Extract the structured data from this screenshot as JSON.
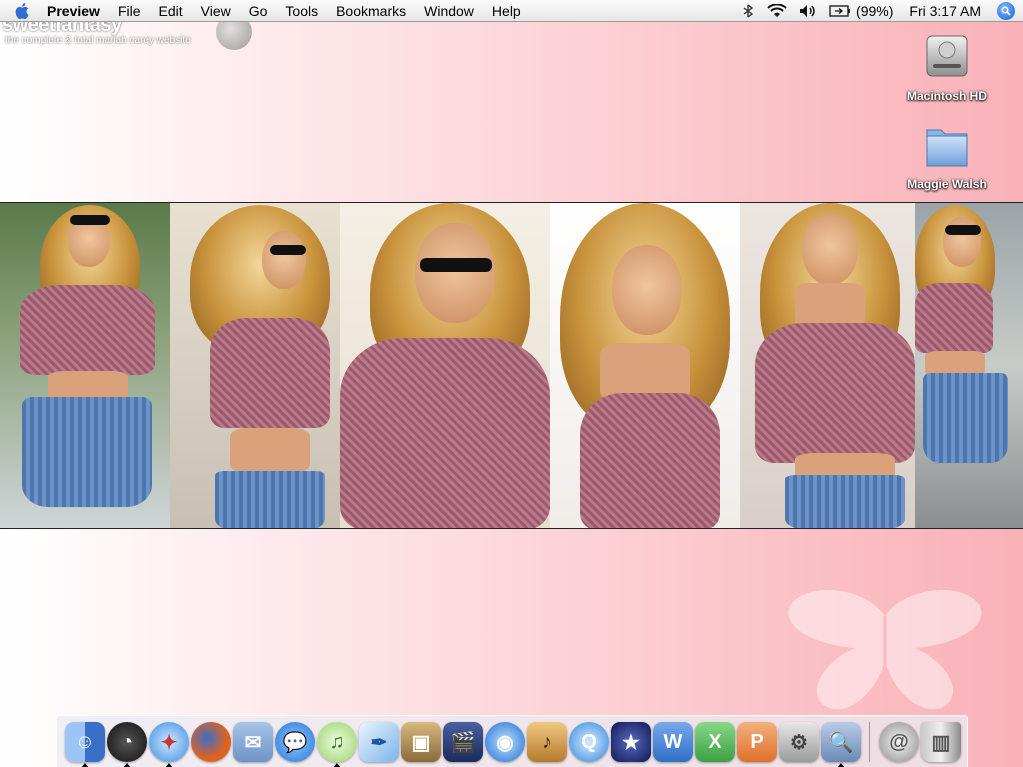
{
  "menubar": {
    "app_name": "Preview",
    "items": [
      "File",
      "Edit",
      "View",
      "Go",
      "Tools",
      "Bookmarks",
      "Window",
      "Help"
    ],
    "battery": "(99%)",
    "clock": "Fri 3:17 AM"
  },
  "wallpaper": {
    "site_name": "sweetfantasy",
    "tagline": "the complete & total mariah carey website"
  },
  "desktop_icons": [
    {
      "label": "Macintosh HD",
      "icon": "hard-drive-icon"
    },
    {
      "label": "Maggie Walsh",
      "icon": "folder-icon"
    }
  ],
  "dock": {
    "apps": [
      {
        "icon": "finder-icon",
        "color": "#4a7fd0"
      },
      {
        "icon": "dashboard-icon",
        "color": "#2b2b2b"
      },
      {
        "icon": "safari-icon",
        "color": "#3b8fe0"
      },
      {
        "icon": "firefox-icon",
        "color": "#e0621f"
      },
      {
        "icon": "mail-icon",
        "color": "#6c93c9"
      },
      {
        "icon": "ichat-icon",
        "color": "#3a8ee6"
      },
      {
        "icon": "itunes-icon",
        "color": "#6fb53a"
      },
      {
        "icon": "feather-icon",
        "color": "#3e88c5"
      },
      {
        "icon": "iphoto-icon",
        "color": "#8a6a3a"
      },
      {
        "icon": "imovie-icon",
        "color": "#2a3f7a"
      },
      {
        "icon": "idvd-icon",
        "color": "#1f6fd6"
      },
      {
        "icon": "garageband-icon",
        "color": "#b57a2c"
      },
      {
        "icon": "quicktime-icon",
        "color": "#2f86e0"
      },
      {
        "icon": "imovie-star-icon",
        "color": "#222a6a"
      },
      {
        "icon": "word-icon",
        "color": "#2f6fc9"
      },
      {
        "icon": "excel-icon",
        "color": "#3aa040"
      },
      {
        "icon": "powerpoint-icon",
        "color": "#e0702a"
      },
      {
        "icon": "system-preferences-icon",
        "color": "#9a9a9a"
      },
      {
        "icon": "preview-icon",
        "color": "#6a8ab5"
      }
    ],
    "trailing": [
      {
        "icon": "internet-location-icon",
        "color": "#8c8c8c"
      },
      {
        "icon": "trash-icon",
        "color": "#7a7a7a"
      }
    ]
  }
}
